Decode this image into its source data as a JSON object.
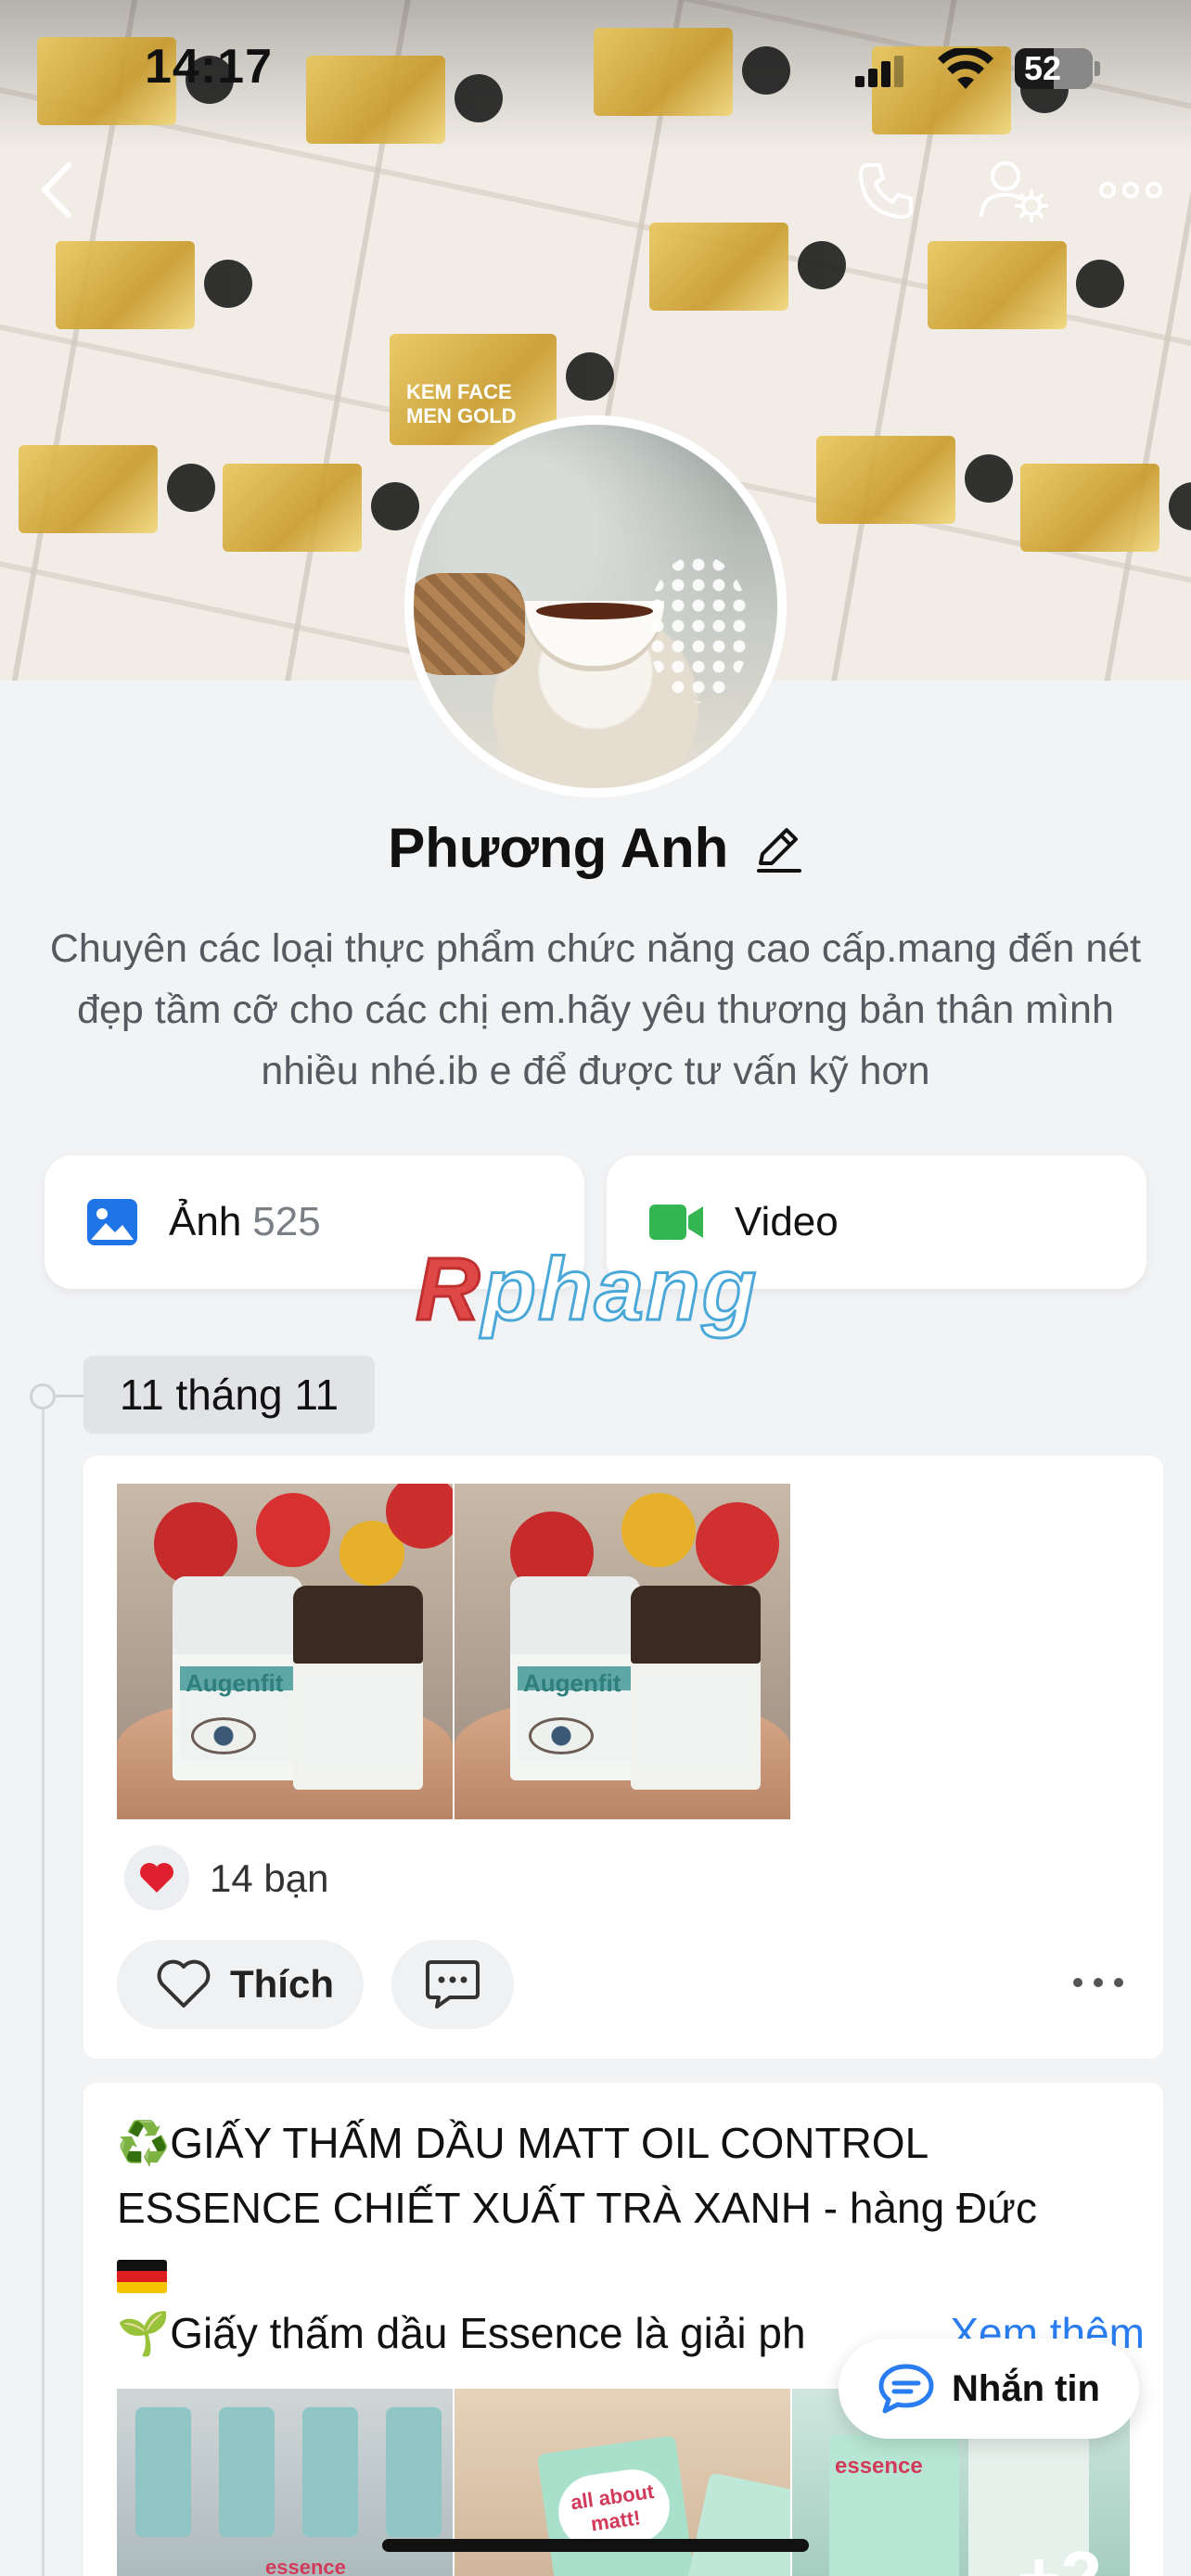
{
  "status_bar": {
    "time": "14:17",
    "battery": "52"
  },
  "cover": {
    "product_text": "KEM FACE MEN GOLD"
  },
  "header": {
    "back_icon": "chevron-left-icon",
    "call_icon": "phone-icon",
    "settings_icon": "user-settings-icon",
    "more_icon": "more-horizontal-icon"
  },
  "profile": {
    "name": "Phương Anh",
    "bio": "Chuyên các loại thực phẩm chức năng cao cấp.mang đến nét đẹp tầm cỡ cho các chị em.hãy yêu thương bản thân mình nhiều nhé.ib e để được tư vấn kỹ hơn"
  },
  "media": {
    "photos_label": "Ảnh",
    "photos_count": "525",
    "video_label": "Video"
  },
  "watermark": {
    "part1": "R",
    "part2": "phang"
  },
  "timeline": {
    "date": "11 tháng 11"
  },
  "post1": {
    "product_label": "Augenfit",
    "reactions": "14 bạn",
    "like_label": "Thích"
  },
  "post2": {
    "title": "♻️GIẤY THẤM DẦU MATT OIL CONTROL ESSENCE CHIẾT XUẤT TRÀ XANH - hàng Đức",
    "line2": "🌱Giấy thấm dầu Essence là giải ph",
    "see_more": "Xem thêm",
    "brand_label": "essence",
    "product_label": "all about matt!",
    "more_count": "+2"
  },
  "floating": {
    "message_label": "Nhắn tin"
  },
  "colors": {
    "accent": "#2a7df0",
    "heart": "#e0202f",
    "video_green": "#34b753",
    "photo_blue": "#1f74e6"
  }
}
